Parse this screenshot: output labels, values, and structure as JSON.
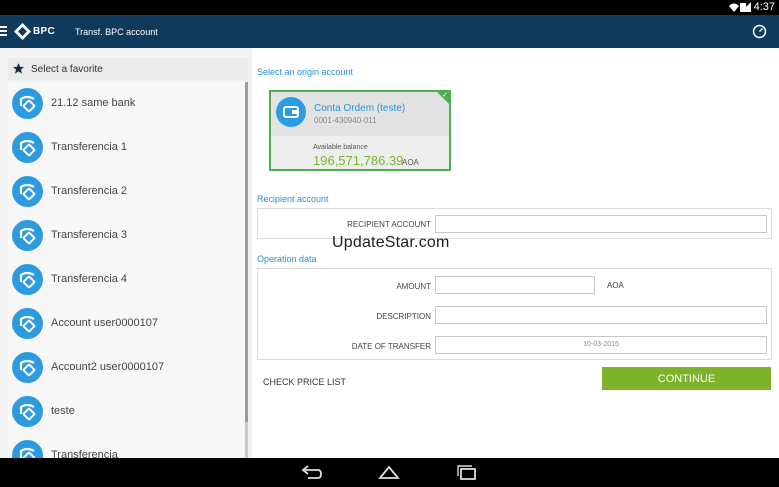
{
  "status_bar": {
    "time": "4:37"
  },
  "app_bar": {
    "brand": "BPC",
    "title": "Transf. BPC account"
  },
  "sidebar": {
    "header": "Select a favorite",
    "favorites": [
      {
        "name": "21.12 same bank"
      },
      {
        "name": "Transferencia 1"
      },
      {
        "name": "Transferencia 2"
      },
      {
        "name": "Transferencia 3"
      },
      {
        "name": "Transferencia 4"
      },
      {
        "name": "Account user0000107"
      },
      {
        "name": "Account2 user0000107"
      },
      {
        "name": "teste"
      },
      {
        "name": "Transferencia"
      }
    ]
  },
  "origin": {
    "section_title": "Select an origin account",
    "account_name": "Conta Ordem (teste)",
    "account_number": "0001-430940-011",
    "balance_label": "Available balance",
    "balance": "196,571,786.39",
    "currency": "AOA"
  },
  "recipient": {
    "section_title": "Recipient account",
    "label": "RECIPIENT ACCOUNT",
    "value": ""
  },
  "operation": {
    "section_title": "Operation data",
    "amount_label": "AMOUNT",
    "amount_value": "",
    "amount_currency": "AOA",
    "description_label": "DESCRIPTION",
    "description_value": "",
    "date_label": "DATE OF TRANSFER",
    "date_value": "10-03-2015"
  },
  "actions": {
    "check_price_list": "CHECK PRICE LIST",
    "continue": "CONTINUE"
  },
  "watermark": "UpdateStar.com",
  "colors": {
    "app_bar": "#0f3a5c",
    "accent_blue": "#2d9be0",
    "section_title": "#2b8fd0",
    "selected_border": "#4caf50",
    "continue_button": "#7cb32b",
    "balance_text": "#7cb32b"
  }
}
